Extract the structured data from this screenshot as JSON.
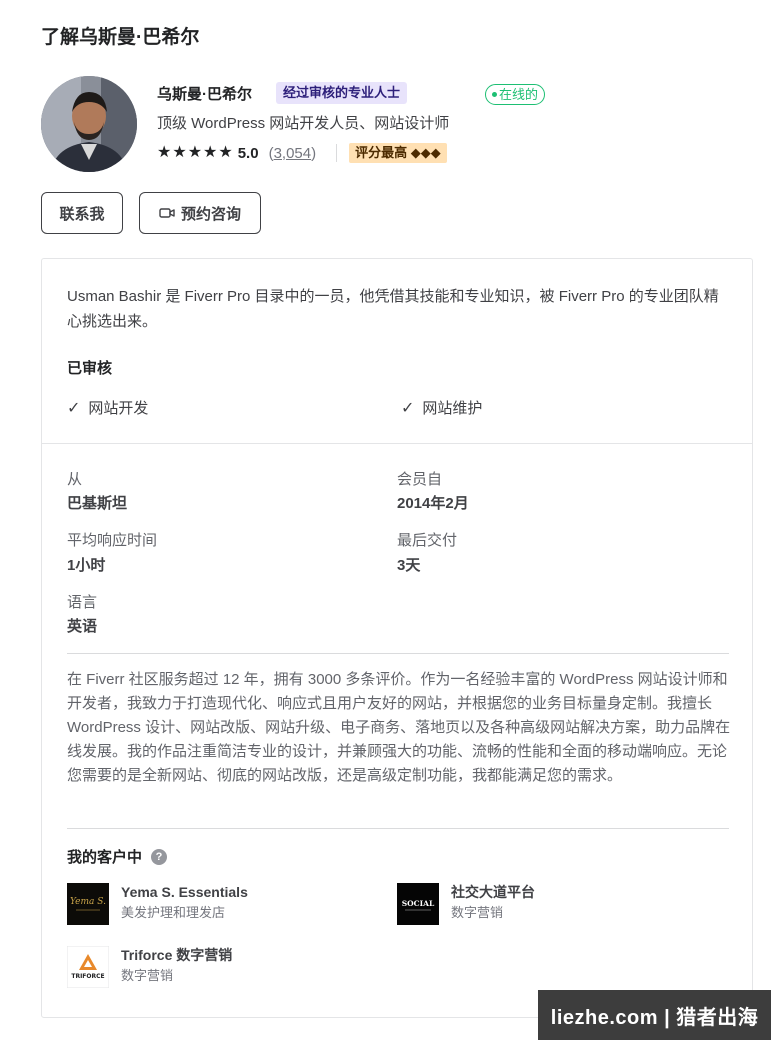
{
  "section_title": "了解乌斯曼·巴希尔",
  "profile": {
    "name": "乌斯曼·巴希尔",
    "pro_badge": "经过审核的专业人士",
    "online_badge": "在线的",
    "headline": "顶级 WordPress 网站开发人员、网站设计师",
    "rating": "5.0",
    "reviews_open": "(",
    "reviews_count": "3,054",
    "reviews_close": ")",
    "stars": 5,
    "top_rated": "评分最高 ◆◆◆"
  },
  "buttons": {
    "contact": "联系我",
    "consult": "预约咨询"
  },
  "card": {
    "intro": "Usman Bashir 是 Fiverr Pro 目录中的一员，他凭借其技能和专业知识，被 Fiverr Pro 的专业团队精心挑选出来。",
    "verified_title": "已审核",
    "verified_items": [
      "网站开发",
      "网站维护"
    ],
    "stats": {
      "from_label": "从",
      "from_value": "巴基斯坦",
      "member_label": "会员自",
      "member_value": "2014年2月",
      "response_label": "平均响应时间",
      "response_value": "1小时",
      "delivery_label": "最后交付",
      "delivery_value": "3天",
      "language_label": "语言",
      "language_value": "英语"
    },
    "description": "在 Fiverr 社区服务超过 12 年，拥有 3000 多条评价。作为一名经验丰富的 WordPress 网站设计师和开发者，我致力于打造现代化、响应式且用户友好的网站，并根据您的业务目标量身定制。我擅长 WordPress 设计、网站改版、网站升级、电子商务、落地页以及各种高级网站解决方案，助力品牌在线发展。我的作品注重简洁专业的设计，并兼顾强大的功能、流畅的性能和全面的移动端响应。无论您需要的是全新网站、彻底的网站改版，还是高级定制功能，我都能满足您的需求。",
    "clients_title": "我的客户中",
    "clients": [
      {
        "name": "Yema S. Essentials",
        "category": "美发护理和理发店",
        "logo_text": "Yema S."
      },
      {
        "name": "社交大道平台",
        "category": "数字营销",
        "logo_text": "SOCIAL"
      },
      {
        "name": "Triforce 数字营销",
        "category": "数字营销",
        "logo_text": "TRIFORCE"
      }
    ]
  },
  "watermark": "liezhe.com | 猎者出海",
  "colors": {
    "accent_green": "#1dbf73",
    "pro_badge_bg": "#e8e3fb",
    "top_rated_bg": "#ffe0b3",
    "text_dark": "#222325"
  }
}
